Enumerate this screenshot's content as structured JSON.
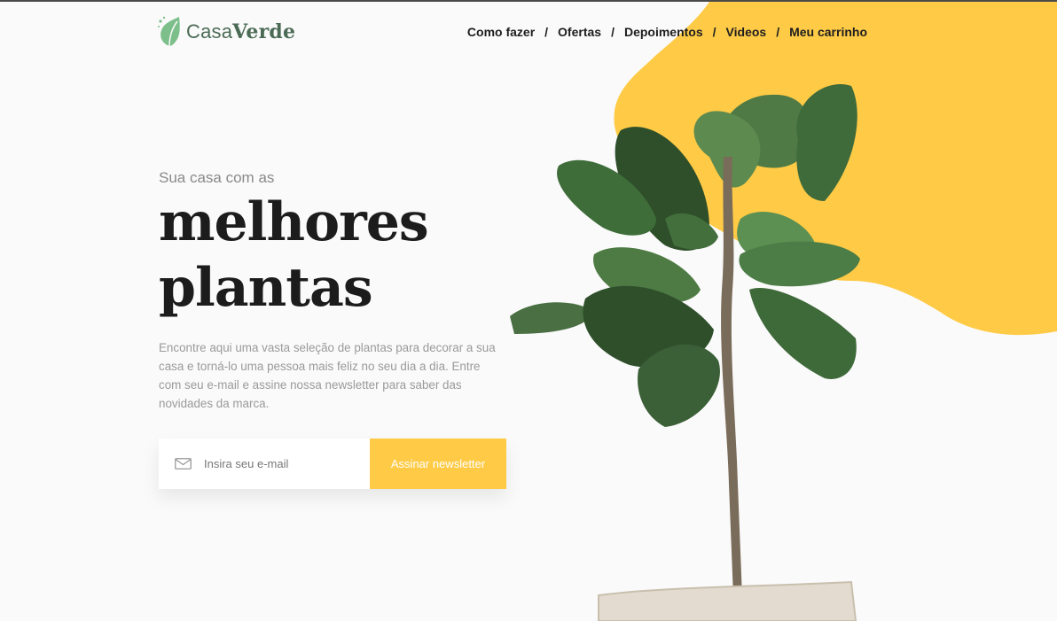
{
  "brand": {
    "name_light": "Casa",
    "name_bold": "Verde",
    "icon": "leaf-icon"
  },
  "nav": {
    "separator": "/",
    "items": [
      "Como fazer",
      "Ofertas",
      "Depoimentos",
      "Videos",
      "Meu carrinho"
    ]
  },
  "hero": {
    "kicker": "Sua casa com as",
    "title_line1": "melhores",
    "title_line2": "plantas",
    "description": "Encontre aqui uma vasta seleção de plantas para decorar a sua casa e torná-lo uma pessoa mais feliz no seu dia a dia. Entre com seu e-mail e assine nossa newsletter para saber das novidades da marca."
  },
  "newsletter": {
    "placeholder": "Insira seu e-mail",
    "button_label": "Assinar newsletter",
    "icon": "mail-icon"
  },
  "colors": {
    "accent": "#ffcb47",
    "brand_green": "#4b6b55",
    "leaf": "#7cbf8a",
    "text": "#1c1c1c"
  }
}
